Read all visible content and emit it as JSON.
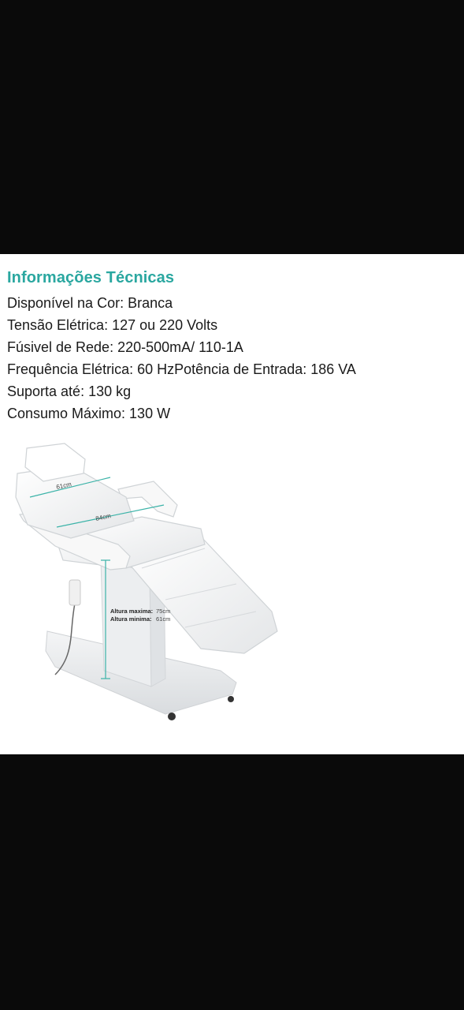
{
  "section": {
    "title": "Informações Técnicas",
    "specs": [
      "Disponível na Cor: Branca",
      "Tensão Elétrica: 127 ou 220 Volts",
      "Fúsivel de Rede: 220-500mA/ 110-1A",
      "Frequência Elétrica: 60 HzPotência de Entrada: 186 VA",
      "Suporta até: 130 kg",
      "Consumo Máximo: 130 W"
    ]
  },
  "product_image": {
    "dim_width_label": "61cm",
    "dim_length_label": "84cm",
    "height_max_label": "Altura maxima:",
    "height_max_value": "75cm",
    "height_min_label": "Altura minima:",
    "height_min_value": "61cm"
  },
  "colors": {
    "heading": "#2aa7a0",
    "background_dark": "#0a0a0a",
    "dimension_line": "#3bb3a8"
  }
}
